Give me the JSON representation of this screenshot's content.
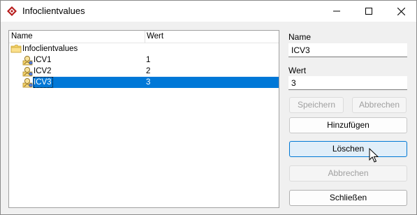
{
  "window": {
    "title": "Infoclientvalues"
  },
  "tree": {
    "columns": {
      "name": "Name",
      "value": "Wert"
    },
    "root": {
      "label": "Infoclientvalues"
    },
    "items": [
      {
        "label": "ICV1",
        "value": "1"
      },
      {
        "label": "ICV2",
        "value": "2"
      },
      {
        "label": "ICV3",
        "value": "3"
      }
    ]
  },
  "form": {
    "name_label": "Name",
    "name_value": "ICV3",
    "value_label": "Wert",
    "value_value": "3"
  },
  "buttons": {
    "save": "Speichern",
    "cancel_edit": "Abbrechen",
    "add": "Hinzufügen",
    "delete": "Löschen",
    "cancel": "Abbrechen",
    "close": "Schließen"
  },
  "colors": {
    "selection": "#0078d7",
    "hover_border": "#0078d4"
  }
}
